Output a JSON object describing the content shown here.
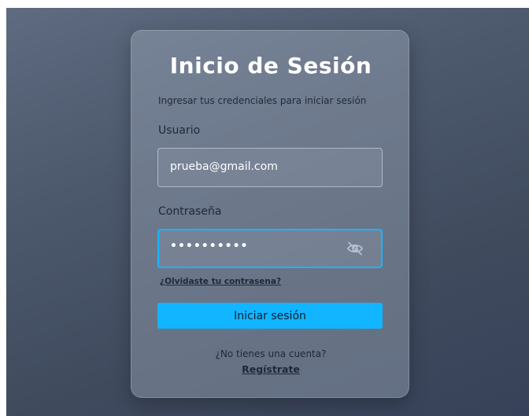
{
  "login": {
    "title": "Inicio de Sesión",
    "subtitle": "Ingresar tus credenciales para iniciar sesión",
    "username_label": "Usuario",
    "username_value": "prueba@gmail.com",
    "password_label": "Contraseña",
    "password_masked": "••••••••••",
    "toggle_icon": "eye-slash-icon",
    "forgot_link": "¿Olvidaste tu contrasena?",
    "submit_label": "Iniciar sesión",
    "no_account_text": "¿No tienes una cuenta?",
    "register_link": "Regístrate"
  },
  "colors": {
    "accent": "#12b5ff",
    "focus_border": "#17b6ff",
    "background": "#46526a"
  }
}
